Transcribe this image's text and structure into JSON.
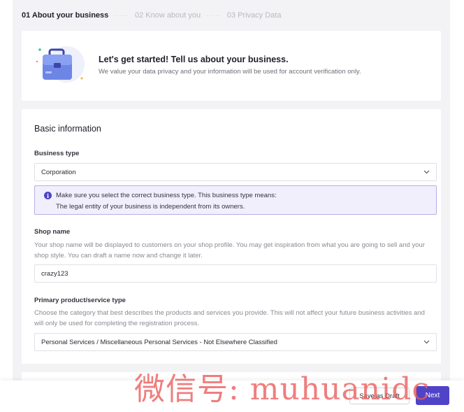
{
  "stepper": {
    "steps": [
      {
        "label": "01 About your business"
      },
      {
        "label": "02 Know about you"
      },
      {
        "label": "03 Privacy Data"
      }
    ],
    "separator": "·····"
  },
  "intro": {
    "title": "Let's get started! Tell us about your business.",
    "subtitle": "We value your data privacy and your information will be used for account verification only.",
    "illustration_icon": "briefcase-icon"
  },
  "basic_info": {
    "title": "Basic information",
    "business_type": {
      "label": "Business type",
      "value": "Corporation"
    },
    "notice": {
      "line1": "Make sure you select the correct business type. This business type means:",
      "line2": "The legal entity of your business is independent from its owners.",
      "icon_glyph": "i"
    },
    "shop_name": {
      "label": "Shop name",
      "hint": "Your shop name will be displayed to customers on your shop profile. You may get inspiration from what you are going to sell and your shop style. You can draft a name now and change it later.",
      "value": "crazy123"
    },
    "product_type": {
      "label": "Primary product/service type",
      "hint": "Choose the category that best describes the products and services you provide. This will not affect your future business activities and will only be used for completing the registration process.",
      "value": "Personal Services / Miscellaneous Personal Services - Not Elsewhere Classified"
    }
  },
  "footer": {
    "save_draft": "Save as Draft",
    "next": "Next"
  },
  "watermark": "微信号: muhuanidc",
  "colors": {
    "accent": "#4f44c8",
    "notice_bg": "#f1effc",
    "notice_border": "#b7aee8",
    "page_bg": "#f3f3f6"
  }
}
